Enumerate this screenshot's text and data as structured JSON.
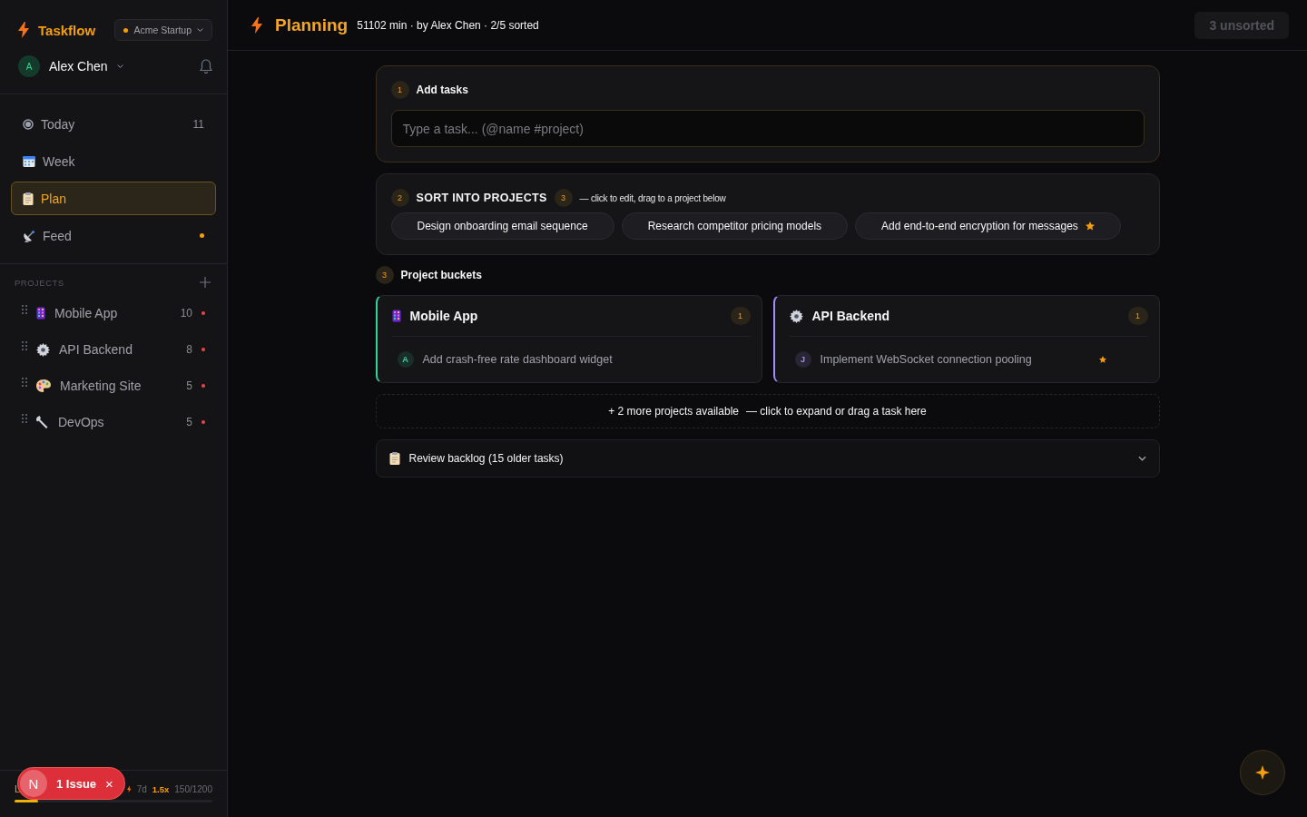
{
  "app": {
    "name": "Taskflow",
    "workspace": "Acme Startup"
  },
  "user": {
    "initial": "A",
    "name": "Alex Chen"
  },
  "nav": [
    {
      "kind": "today",
      "label": "Today",
      "count": "11",
      "selected": false,
      "unread": false
    },
    {
      "kind": "week",
      "label": "Week",
      "selected": false,
      "unread": false
    },
    {
      "kind": "plan",
      "label": "Plan",
      "selected": true,
      "unread": false
    },
    {
      "kind": "feed",
      "label": "Feed",
      "selected": false,
      "unread": true
    }
  ],
  "projects_heading": "PROJECTS",
  "projects": [
    {
      "kind": "phone",
      "name": "Mobile App",
      "count": "10",
      "overdue": true
    },
    {
      "kind": "gear",
      "name": "API Backend",
      "count": "8",
      "overdue": true
    },
    {
      "kind": "palette",
      "name": "Marketing Site",
      "count": "5",
      "overdue": true
    },
    {
      "kind": "wrench",
      "name": "DevOps",
      "count": "5",
      "overdue": true
    }
  ],
  "footer": {
    "level_label": "L",
    "streak": "7d",
    "multiplier": "1.5x",
    "xp": "150/1200",
    "level": 0.12
  },
  "issue_badge": {
    "initial": "N",
    "label": "1 Issue",
    "close": "×"
  },
  "header": {
    "title": "Planning",
    "meta": "51102 min · by Alex Chen · 2/5 sorted",
    "unsorted": "3 unsorted"
  },
  "step_add": {
    "number": "1",
    "title": "Add tasks",
    "placeholder": "Type a task... (@name #project)"
  },
  "step_sort": {
    "number": "2",
    "title": "SORT INTO PROJECTS",
    "count": "3",
    "hint": "— click to edit, drag to a project below",
    "tasks": [
      {
        "label": "Design onboarding email sequence",
        "starred": false
      },
      {
        "label": "Research competitor pricing models",
        "starred": false
      },
      {
        "label": "Add end-to-end encryption for messages",
        "starred": true
      }
    ]
  },
  "step_buckets": {
    "number": "3",
    "title": "Project buckets"
  },
  "buckets": [
    {
      "kind": "phone",
      "name": "Mobile App",
      "count": "1",
      "color": "#34d399",
      "tasks": [
        {
          "initial": "A",
          "label": "Add crash-free rate dashboard widget",
          "starred": false
        }
      ]
    },
    {
      "kind": "gear",
      "name": "API Backend",
      "count": "1",
      "color": "#a78bfa",
      "tasks": [
        {
          "initial": "J",
          "label": "Implement WebSocket connection pooling",
          "starred": true
        }
      ]
    }
  ],
  "more_projects": {
    "label": "+ 2 more projects available",
    "hint": "— click to expand or drag a task here"
  },
  "backlog": {
    "label": "Review backlog (15 older tasks)",
    "expanded": false
  }
}
